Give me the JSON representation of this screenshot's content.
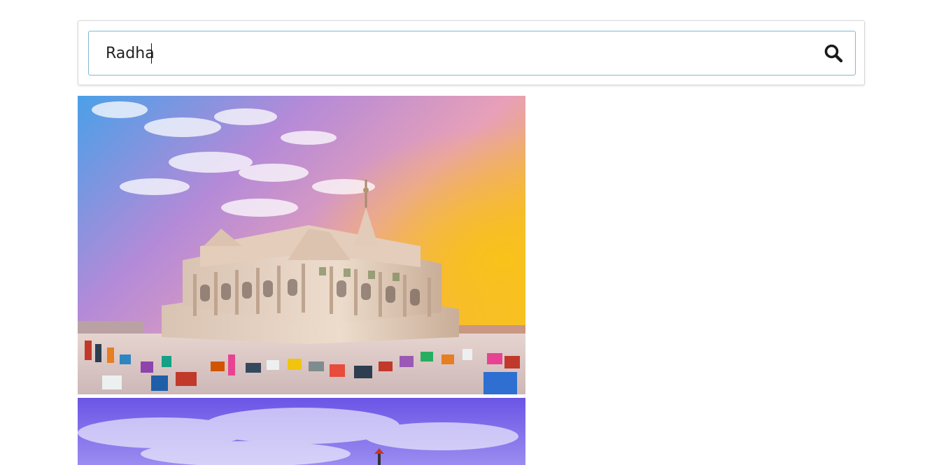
{
  "search": {
    "value": "Radha",
    "placeholder": "",
    "icon": "search-icon"
  },
  "results": [
    {
      "kind": "image",
      "subject": "temple-at-sunset-photo"
    },
    {
      "kind": "image",
      "subject": "blue-sky-statue-photo"
    }
  ],
  "colors": {
    "input_border": "#7fb9cf",
    "card_border": "#d9d9d9"
  }
}
